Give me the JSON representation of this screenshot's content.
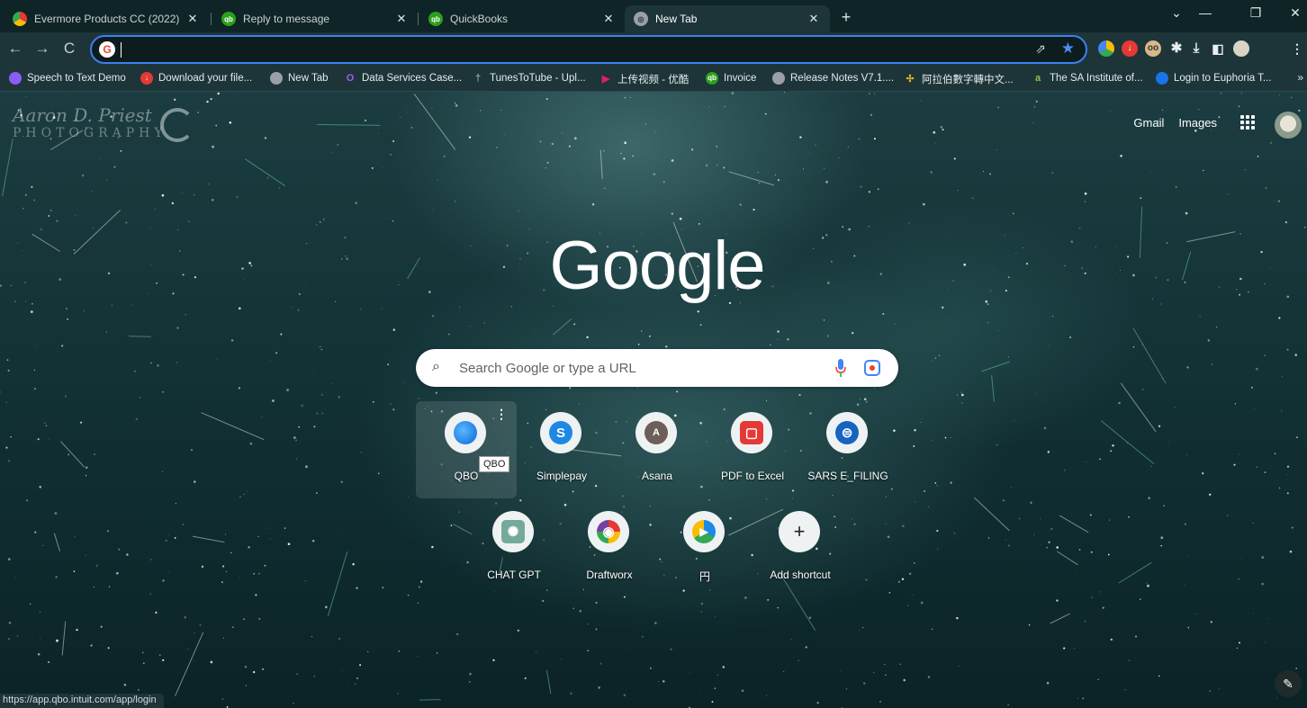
{
  "tabs": [
    {
      "title": "Evermore Products CC (2022)",
      "icon": "evermore-icon",
      "active": false
    },
    {
      "title": "Reply to message",
      "icon": "qb-icon",
      "active": false
    },
    {
      "title": "QuickBooks",
      "icon": "qb-icon",
      "active": false
    },
    {
      "title": "New Tab",
      "icon": "chrome-icon",
      "active": true
    }
  ],
  "tab_close": "✕",
  "new_tab_symbol": "+",
  "window_controls": {
    "dropdown": "⌄",
    "minimize": "—",
    "maximize": "❐",
    "close": "✕"
  },
  "toolbar": {
    "back": "←",
    "forward": "→",
    "reload": "C",
    "address_value": ""
  },
  "bookmarks": [
    {
      "label": "Speech to Text Demo",
      "icon": "speech-icon",
      "color": "#8b5cf6"
    },
    {
      "label": "Download your file...",
      "icon": "download-red-icon",
      "color": "#e53935"
    },
    {
      "label": "New Tab",
      "icon": "chrome-icon",
      "color": "#9aa0a6"
    },
    {
      "label": "Data Services Case...",
      "icon": "ds-icon",
      "color": "#a855f7"
    },
    {
      "label": "TunesToTube - Upl...",
      "icon": "tunes-icon",
      "color": "#9aa0a6"
    },
    {
      "label": "上传视频 - 优酷",
      "icon": "youku-icon",
      "color": "#e91e63"
    },
    {
      "label": "Invoice",
      "icon": "qb-icon",
      "color": "#2ca01c"
    },
    {
      "label": "Release Notes V7.1....",
      "icon": "chrome-icon",
      "color": "#9aa0a6"
    },
    {
      "label": "阿拉伯數字轉中文...",
      "icon": "slack-icon",
      "color": "#ecb22e"
    },
    {
      "label": "The SA Institute of...",
      "icon": "sa-icon",
      "color": "#8bc34a"
    },
    {
      "label": "Login to Euphoria T...",
      "icon": "euphoria-icon",
      "color": "#1a73e8"
    }
  ],
  "bookmarks_more": "»",
  "ntp": {
    "photo_credit_name": "Aaron D. Priest",
    "photo_credit_sub": "PHOTOGRAPHY",
    "top_links": [
      "Gmail",
      "Images"
    ],
    "logo_text": "Google",
    "search_placeholder": "Search Google or type a URL",
    "shortcuts": [
      {
        "label": "QBO",
        "icon": "qbo-icon",
        "color": "#1a8cff",
        "glyph": ""
      },
      {
        "label": "Simplepay",
        "icon": "simplepay-icon",
        "color": "#1e88e5",
        "glyph": "S"
      },
      {
        "label": "Asana",
        "icon": "asana-icon",
        "color": "#6d5f57",
        "glyph": "A"
      },
      {
        "label": "PDF to Excel",
        "icon": "pdf-excel-icon",
        "color": "#e53935",
        "glyph": "▢"
      },
      {
        "label": "SARS E_FILING",
        "icon": "sars-icon",
        "color": "#1565c0",
        "glyph": "⊜"
      },
      {
        "label": "CHAT GPT",
        "icon": "chatgpt-icon",
        "color": "#74aa9c",
        "glyph": "✺"
      },
      {
        "label": "Draftworx",
        "icon": "draftworx-icon",
        "color": "#7b3fa0",
        "glyph": "◉"
      },
      {
        "label": "円",
        "icon": "play-icon",
        "color": "#1e88e5",
        "glyph": "▶"
      },
      {
        "label": "Add shortcut",
        "icon": "plus-icon",
        "color": "#eef2f3",
        "glyph": "+"
      }
    ],
    "tooltip": "QBO",
    "status_url": "https://app.qbo.intuit.com/app/login",
    "customize_glyph": "✎"
  }
}
